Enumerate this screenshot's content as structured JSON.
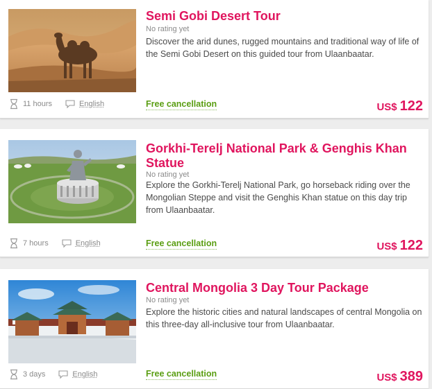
{
  "colors": {
    "title": "#e0155e",
    "price": "#e0155e",
    "free_cancellation": "#5a9e12",
    "muted": "#8a8a8a",
    "background": "#ededed"
  },
  "tours": [
    {
      "title": "Semi Gobi Desert Tour",
      "rating": "No rating yet",
      "description": "Discover the arid dunes, rugged mountains and traditional way of life of the Semi Gobi Desert on this guided tour from Ulaanbaatar.",
      "duration": "11 hours",
      "language": "English",
      "cancellation": "Free cancellation",
      "currency": "US$",
      "price": "122",
      "image": "camel-in-desert"
    },
    {
      "title": "Gorkhi-Terelj National Park & Genghis Khan Statue",
      "rating": "No rating yet",
      "description": "Explore the Gorkhi-Terelj National Park, go horseback riding over the Mongolian Steppe and visit the Genghis Khan statue on this day trip from Ulaanbaatar.",
      "duration": "7 hours",
      "language": "English",
      "cancellation": "Free cancellation",
      "currency": "US$",
      "price": "122",
      "image": "genghis-khan-statue"
    },
    {
      "title": "Central Mongolia 3 Day Tour Package",
      "rating": "No rating yet",
      "description": "Explore the historic cities and natural landscapes of central Mongolia on this three-day all-inclusive tour from Ulaanbaatar.",
      "duration": "3 days",
      "language": "English",
      "cancellation": "Free cancellation",
      "currency": "US$",
      "price": "389",
      "image": "monastery-in-snow"
    }
  ],
  "icons": {
    "duration": "hourglass-icon",
    "language": "speech-bubble-icon"
  }
}
